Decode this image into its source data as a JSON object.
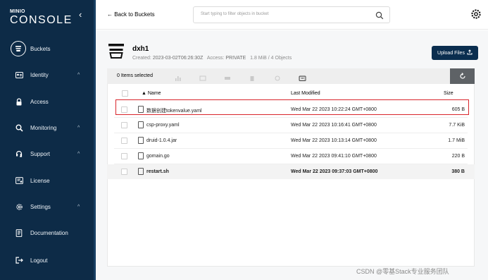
{
  "brand": {
    "top": "MINIO",
    "main": "CONSOLE"
  },
  "sidebar": {
    "items": [
      {
        "label": "Buckets",
        "icon": "bucket-icon",
        "chevron": false
      },
      {
        "label": "Identity",
        "icon": "identity-icon",
        "chevron": true
      },
      {
        "label": "Access",
        "icon": "lock-icon",
        "chevron": false
      },
      {
        "label": "Monitoring",
        "icon": "magnifier-icon",
        "chevron": true
      },
      {
        "label": "Support",
        "icon": "support-icon",
        "chevron": true
      },
      {
        "label": "License",
        "icon": "license-icon",
        "chevron": false
      },
      {
        "label": "Settings",
        "icon": "gear-icon",
        "chevron": true
      },
      {
        "label": "Documentation",
        "icon": "document-icon",
        "chevron": false
      },
      {
        "label": "Logout",
        "icon": "logout-icon",
        "chevron": false
      }
    ]
  },
  "header": {
    "back_label": "← Back to Buckets",
    "search_placeholder": "Start typing to filter objects in bucket"
  },
  "bucket": {
    "name": "dxh1",
    "created_label": "Created:",
    "created_value": "2023-03-02T06:26:30Z",
    "access_label": "Access:",
    "access_value": "PRIVATE",
    "usage": "1.8 MiB / 4 Objects",
    "upload_label": "Upload Files"
  },
  "toolbar": {
    "selected_label": "0 Items selected"
  },
  "table": {
    "columns": {
      "name": "Name",
      "last_modified": "Last Modified",
      "size": "Size"
    },
    "rows": [
      {
        "name": "数据创建tokenvalue.yaml",
        "modified": "Wed Mar 22 2023 10:22:24 GMT+0800",
        "size": "605 B",
        "bold": false
      },
      {
        "name": "csp-proxy.yaml",
        "modified": "Wed Mar 22 2023 10:16:41 GMT+0800",
        "size": "7.7 KiB",
        "bold": false
      },
      {
        "name": "druid-1.0.4.jar",
        "modified": "Wed Mar 22 2023 10:13:14 GMT+0800",
        "size": "1.7 MiB",
        "bold": false
      },
      {
        "name": "gomain.go",
        "modified": "Wed Mar 22 2023 09:41:10 GMT+0800",
        "size": "220 B",
        "bold": false
      },
      {
        "name": "restart.sh",
        "modified": "Wed Mar 22 2023 09:37:03 GMT+0800",
        "size": "380 B",
        "bold": true
      }
    ]
  },
  "watermark": "CSDN @零基Stack专业服务团队",
  "colors": {
    "sidebar": "#0d2b47",
    "primary_button": "#0b2e4f",
    "highlight": "#d9252b"
  }
}
